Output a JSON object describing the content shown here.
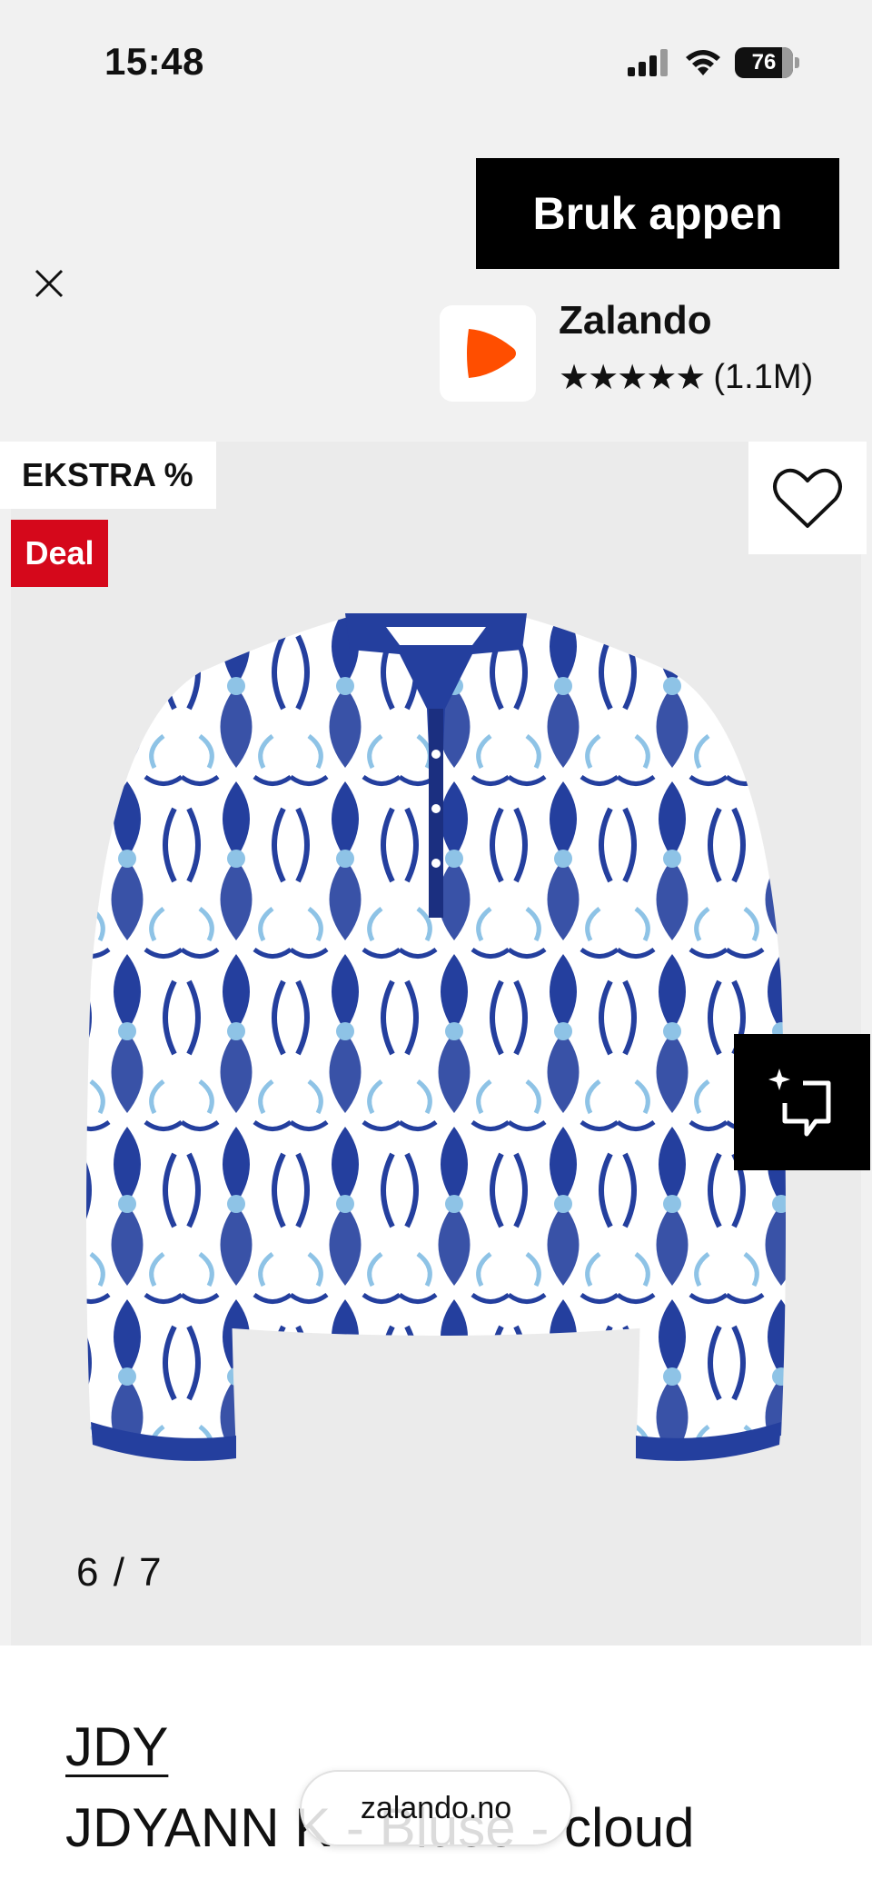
{
  "status_bar": {
    "time": "15:48",
    "battery": "76",
    "icons": [
      "cellular-signal-icon",
      "wifi-icon",
      "battery-icon"
    ]
  },
  "app_banner": {
    "open_app_label": "Bruk appen",
    "app_name": "Zalando",
    "stars": "★★★★★",
    "rating_count": "(1.1M)",
    "star_rating": 5,
    "icons": [
      "close-icon",
      "zalando-logo-icon",
      "star-icon"
    ]
  },
  "product_gallery": {
    "badge_extra": "EKSTRA %",
    "badge_deal": "Deal",
    "image_counter": "6 / 7",
    "icons": [
      "heart-icon",
      "find-similar-icon"
    ]
  },
  "product": {
    "brand": "JDY",
    "name": "JDYANN    K - Bluse - cloud"
  },
  "browser": {
    "url": "zalando.no"
  },
  "colors": {
    "black": "#000000",
    "deal_red": "#d5081b",
    "zalando_orange": "#ff4e00",
    "print_blue": "#243f9e",
    "print_light_blue": "#8ec3e6"
  }
}
